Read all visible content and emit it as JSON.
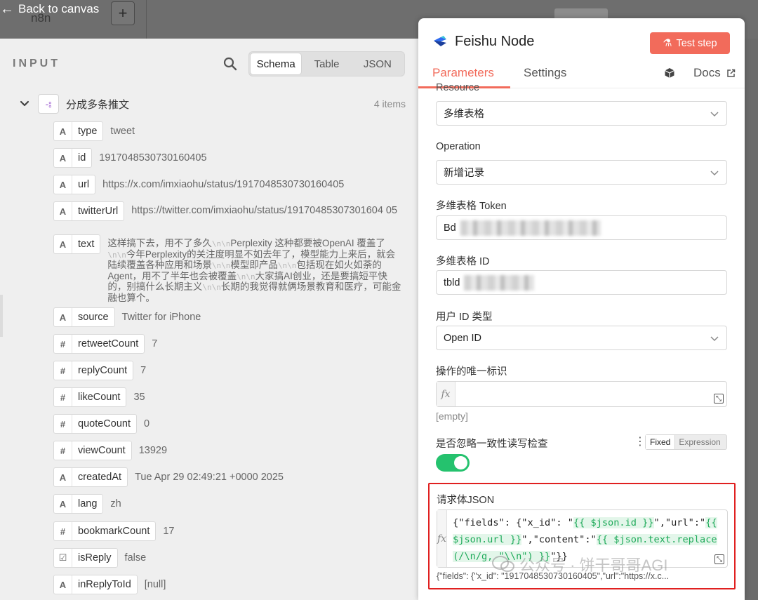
{
  "topbar": {
    "back_label": "Back to canvas",
    "workflow_name_partial": "n8n",
    "add_label": "+"
  },
  "input_panel": {
    "title": "INPUT",
    "view_tabs": [
      "Schema",
      "Table",
      "JSON"
    ],
    "active_view": "Schema",
    "group": {
      "name": "分成多条推文",
      "count_label": "4 items"
    },
    "fields": [
      {
        "type_icon": "A",
        "name": "type",
        "value": "tweet"
      },
      {
        "type_icon": "A",
        "name": "id",
        "value": "1917048530730160405"
      },
      {
        "type_icon": "A",
        "name": "url",
        "value": "https://x.com/imxiaohu/status/1917048530730160405"
      },
      {
        "type_icon": "A",
        "name": "twitterUrl",
        "value": "https://twitter.com/imxiaohu/status/19170485307301604 05"
      },
      {
        "type_icon": "A",
        "name": "text",
        "value_parts": [
          "这样搞下去，用不了多久",
          "\\n\\n",
          "Perplexity 这种都要被OpenAI 覆盖了",
          "\\n\\n",
          "今年Perplexity的关注度明显不如去年了，模型能力上来后，就会陆续覆盖各种应用和场景",
          "\\n\\n",
          "模型即产品",
          "\\n\\n",
          "包括现在如火如荼的Agent，用不了半年也会被覆盖",
          "\\n\\n",
          "大家搞AI创业，还是要搞短平快的，别搞什么长期主义",
          "\\n\\n",
          "长期的我觉得就俩场景教育和医疗，可能金融也算个。"
        ]
      },
      {
        "type_icon": "A",
        "name": "source",
        "value": "Twitter for iPhone"
      },
      {
        "type_icon": "#",
        "name": "retweetCount",
        "value": "7"
      },
      {
        "type_icon": "#",
        "name": "replyCount",
        "value": "7"
      },
      {
        "type_icon": "#",
        "name": "likeCount",
        "value": "35"
      },
      {
        "type_icon": "#",
        "name": "quoteCount",
        "value": "0"
      },
      {
        "type_icon": "#",
        "name": "viewCount",
        "value": "13929"
      },
      {
        "type_icon": "A",
        "name": "createdAt",
        "value": "Tue Apr 29 02:49:21 +0000 2025"
      },
      {
        "type_icon": "A",
        "name": "lang",
        "value": "zh"
      },
      {
        "type_icon": "#",
        "name": "bookmarkCount",
        "value": "17"
      },
      {
        "type_icon": "☑",
        "name": "isReply",
        "value": "false"
      },
      {
        "type_icon": "A",
        "name": "inReplyToId",
        "value": "[null]"
      }
    ]
  },
  "node_panel": {
    "drag_handle": "⠿⠿",
    "title": "Feishu Node",
    "test_button": "Test step",
    "tabs": [
      "Parameters",
      "Settings"
    ],
    "active_tab": "Parameters",
    "docs_label": "Docs",
    "form": {
      "resource_label": "Resource",
      "resource_value": "多维表格",
      "operation_label": "Operation",
      "operation_value": "新增记录",
      "token_label": "多维表格 Token",
      "token_value": "Bd",
      "table_id_label": "多维表格 ID",
      "table_id_value": "tbld",
      "user_id_type_label": "用户 ID 类型",
      "user_id_type_value": "Open ID",
      "unique_id_label": "操作的唯一标识",
      "unique_id_empty": "[empty]",
      "ignore_check_label": "是否忽略一致性读写检查",
      "mode_fixed": "Fixed",
      "mode_expression": "Expression",
      "ignore_check_enabled": true,
      "json_label": "请求体JSON",
      "json_parts": [
        {
          "text": "{\"fields\": {\"x_id\": \"",
          "hl": false
        },
        {
          "text": "{{ $json.id }}",
          "hl": true
        },
        {
          "text": "\",\"url\":\"",
          "hl": false
        },
        {
          "text": "{{ $json.url }}",
          "hl": true
        },
        {
          "text": "\",\"content\":\"",
          "hl": false
        },
        {
          "text": "{{ $json.text.replace(/\\n/g, \"\\\\n\") }}",
          "hl": true
        },
        {
          "text": "\"}}",
          "hl": false
        }
      ],
      "json_result": "{\"fields\": {\"x_id\": \"1917048530730160405\",\"url\":\"https://x.c..."
    }
  },
  "watermark": "公众号 · 饼干哥哥AGI",
  "colors": {
    "accent": "#f26b5b",
    "toggle_on": "#25c26e",
    "highlight_box": "#e02020",
    "expression": "#1faa5a"
  }
}
